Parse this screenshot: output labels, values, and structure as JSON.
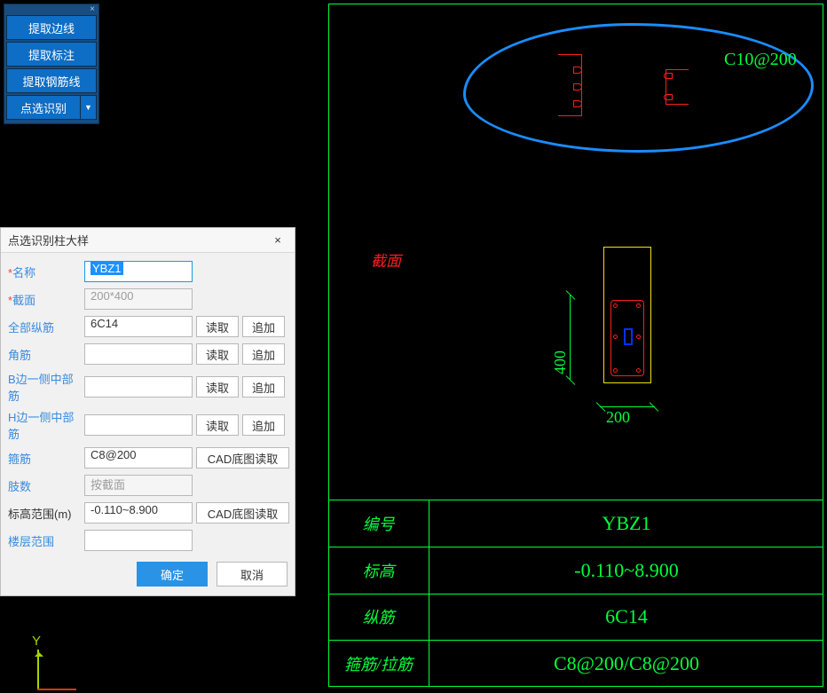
{
  "toolbar": {
    "items": [
      "提取边线",
      "提取标注",
      "提取钢筋线",
      "点选识别"
    ]
  },
  "dialog": {
    "title": "点选识别柱大样",
    "labels": {
      "name": "名称",
      "section": "截面",
      "all_bars": "全部纵筋",
      "corner": "角筋",
      "b_side": "B边一侧中部筋",
      "h_side": "H边一侧中部筋",
      "stirrup": "箍筋",
      "limbs": "肢数",
      "elev_range": "标高范围(m)",
      "floor_range": "楼层范围"
    },
    "required": "*",
    "values": {
      "name": "YBZ1",
      "section": "200*400",
      "all_bars": "6C14",
      "corner": "",
      "b_side": "",
      "h_side": "",
      "stirrup": "C8@200",
      "limbs": "按截面",
      "elev_range": "-0.110~8.900",
      "floor_range": ""
    },
    "btns": {
      "read": "读取",
      "add": "追加",
      "cad_read": "CAD底图读取",
      "ok": "确定",
      "cancel": "取消"
    }
  },
  "canvas": {
    "rebar_spec": "C10@200",
    "side_label": "截面",
    "dim_v": "400",
    "dim_h": "200"
  },
  "info_table": {
    "rows": [
      {
        "label": "编号",
        "value": "YBZ1"
      },
      {
        "label": "标高",
        "value": "-0.110~8.900"
      },
      {
        "label": "纵筋",
        "value": "6C14"
      },
      {
        "label": "箍筋/拉筋",
        "value": "C8@200/C8@200"
      }
    ]
  },
  "axis": {
    "y": "Y"
  }
}
